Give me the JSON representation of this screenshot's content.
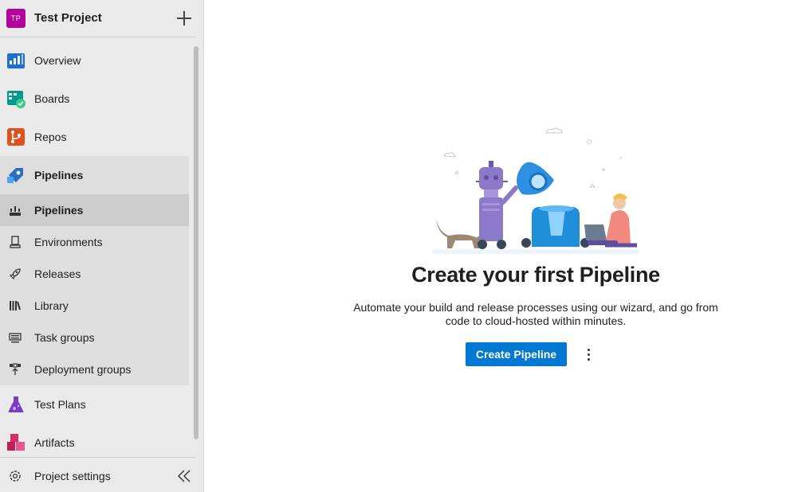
{
  "project": {
    "initials": "TP",
    "name": "Test Project",
    "badge_color": "#b4009e"
  },
  "nav": {
    "overview": "Overview",
    "boards": "Boards",
    "repos": "Repos",
    "pipelines": "Pipelines",
    "test_plans": "Test Plans",
    "artifacts": "Artifacts"
  },
  "pipelines_sub": {
    "pipelines": "Pipelines",
    "environments": "Environments",
    "releases": "Releases",
    "library": "Library",
    "task_groups": "Task groups",
    "deployment_groups": "Deployment groups"
  },
  "footer": {
    "settings": "Project settings"
  },
  "empty_state": {
    "title": "Create your first Pipeline",
    "description": "Automate your build and release processes using our wizard, and go from code to cloud-hosted within minutes.",
    "button": "Create Pipeline"
  },
  "colors": {
    "accent": "#0078d4",
    "sidebar_bg": "#eaeaea",
    "submenu_bg": "#dedede",
    "selected_bg": "#cccccc"
  },
  "icons": {
    "overview": "overview-icon",
    "boards": "boards-icon",
    "repos": "repos-icon",
    "pipelines": "pipelines-icon",
    "test_plans": "test-plans-icon",
    "artifacts": "artifacts-icon",
    "settings": "gear-icon",
    "collapse": "double-chevron-left-icon"
  }
}
